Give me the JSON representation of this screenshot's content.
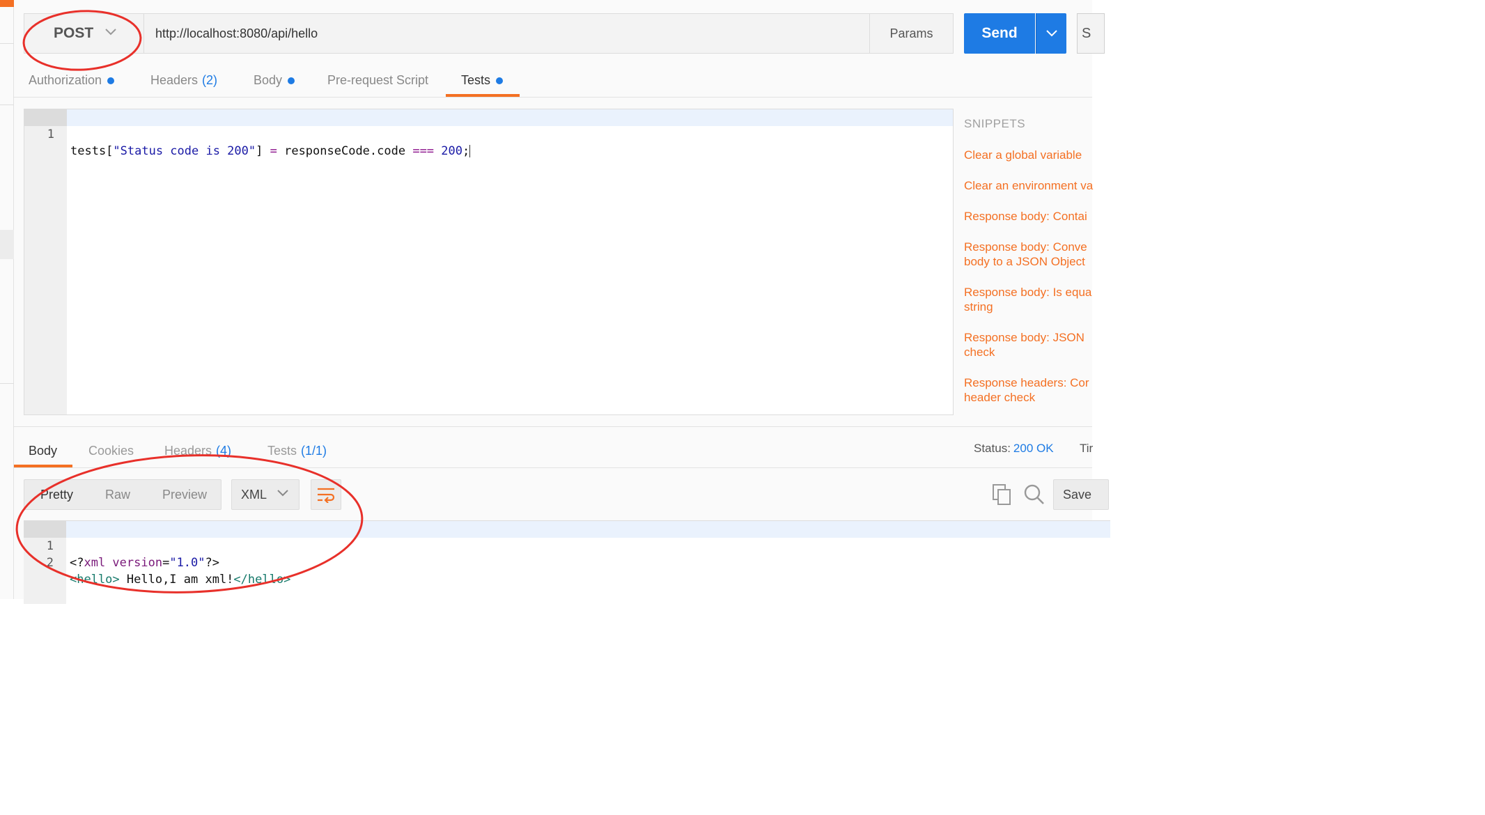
{
  "request": {
    "method": "POST",
    "url": "http://localhost:8080/api/hello",
    "params_label": "Params",
    "send_label": "Send",
    "save_label_partial": "S"
  },
  "request_tabs": [
    {
      "label": "Authorization",
      "count": "",
      "dot": true
    },
    {
      "label": "Headers",
      "count": "(2)",
      "dot": false
    },
    {
      "label": "Body",
      "count": "",
      "dot": true
    },
    {
      "label": "Pre-request Script",
      "count": "",
      "dot": false
    },
    {
      "label": "Tests",
      "count": "",
      "dot": true,
      "active": true
    }
  ],
  "tests_editor": {
    "line_numbers": [
      "1"
    ],
    "line1": {
      "p1": "tests[",
      "p2": "\"Status code is 200\"",
      "p3": "] ",
      "p4": "=",
      "p5": " responseCode.code ",
      "p6": "===",
      "p7": " ",
      "p8": "200",
      "p9": ";"
    }
  },
  "snippets": {
    "title": "SNIPPETS",
    "items": [
      "Clear a global variable",
      "Clear an environment va",
      "Response body: Contai",
      "Response body: Conve\nbody to a JSON Object",
      "Response body: Is equa\nstring",
      "Response body: JSON\ncheck",
      "Response headers: Cor\nheader check"
    ]
  },
  "response_tabs": [
    {
      "label": "Body",
      "count": "",
      "active": true
    },
    {
      "label": "Cookies",
      "count": ""
    },
    {
      "label": "Headers",
      "count": "(4)"
    },
    {
      "label": "Tests",
      "count": "(1/1)"
    }
  ],
  "status": {
    "label": "Status:",
    "value": "200 OK",
    "time_partial": "Tir"
  },
  "view_modes": [
    "Pretty",
    "Raw",
    "Preview"
  ],
  "format": "XML",
  "save_response_label": "Save",
  "response_body": {
    "line_numbers": [
      "1",
      "2"
    ],
    "line1": {
      "p1": "<?",
      "p2": "xml version",
      "p3": "=",
      "p4": "\"1.0\"",
      "p5": "?>"
    },
    "line2": {
      "open": "<hello>",
      "text": " Hello,I am xml!",
      "close": "</hello>"
    }
  },
  "colors": {
    "accent_orange": "#f47023",
    "primary_blue": "#1e7be4",
    "annotation_red": "#e8302a"
  }
}
